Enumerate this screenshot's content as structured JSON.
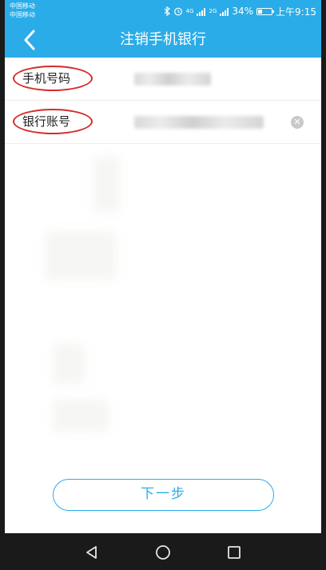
{
  "status_bar": {
    "carrier_1": "中国移动",
    "carrier_2": "中国移动",
    "net_1": "4G",
    "net_2": "2G",
    "battery": "34%",
    "battery_level": 0.34,
    "time": "上午9:15"
  },
  "header": {
    "title": "注销手机银行",
    "back_icon": "chevron-left-icon"
  },
  "form": {
    "phone_label": "手机号码",
    "account_label": "银行账号",
    "clear_icon": "clear-circle-icon",
    "annotation_color": "#d62b2b"
  },
  "actions": {
    "next_label": "下一步"
  },
  "nav": {
    "back_icon": "triangle-back-icon",
    "home_icon": "circle-home-icon",
    "recents_icon": "square-recents-icon"
  },
  "colors": {
    "accent": "#2aace8"
  }
}
